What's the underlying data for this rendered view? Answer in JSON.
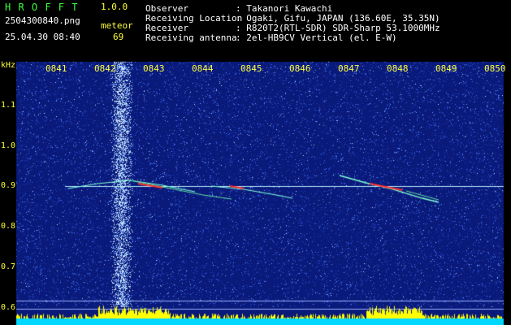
{
  "app": {
    "title": "H R O F F T",
    "version": "1.0.0",
    "filename": "2504300840.png",
    "datetime": "25.04.30 08:40",
    "meteor_label": "meteor",
    "meteor_count": "69"
  },
  "station": {
    "rows": [
      {
        "label": "Observer",
        "value": ": Takanori Kawachi"
      },
      {
        "label": "Receiving Location",
        "value": ": Ogaki, Gifu, JAPAN (136.60E, 35.35N)"
      },
      {
        "label": "Receiver",
        "value": ": R820T2(RTL-SDR) SDR-Sharp 53.1000MHz"
      },
      {
        "label": "Receiving antenna",
        "value": ": 2el-HB9CV Vertical (el. E-W)"
      }
    ]
  },
  "spectrogram": {
    "y_unit": "kHz",
    "y_ticks": [
      "1.1",
      "1.0",
      "0.9",
      "0.8",
      "0.7",
      "0.6"
    ],
    "x_ticks": [
      "0841",
      "0842",
      "0843",
      "0844",
      "0845",
      "0846",
      "0847",
      "0848",
      "0849",
      "0850"
    ],
    "colors": {
      "background": "#0a1a7a",
      "noise": "#3a6dff",
      "trace": "#7fffd4",
      "hot": "#ff3030",
      "level": "#ffff00",
      "level_base": "#00d8ff",
      "label": "#ffff3a"
    }
  }
}
